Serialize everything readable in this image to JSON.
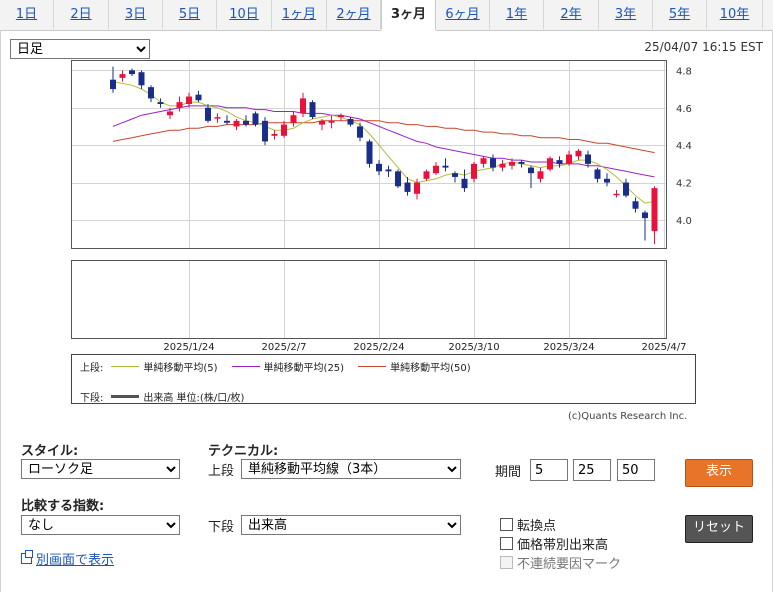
{
  "tabs": [
    "1日",
    "2日",
    "3日",
    "5日",
    "10日",
    "1ヶ月",
    "2ヶ月",
    "3ヶ月",
    "6ヶ月",
    "1年",
    "2年",
    "3年",
    "5年",
    "10年"
  ],
  "active_tab": "3ヶ月",
  "chart_type_select": "日足",
  "timestamp": "25/04/07 16:15 EST",
  "copyright": "(c)Quants Research Inc.",
  "legend": {
    "upper_label": "上段:",
    "lower_label": "下段:",
    "ma5": "単純移動平均(5)",
    "ma25": "単純移動平均(25)",
    "ma50": "単純移動平均(50)",
    "volume": "出来高 単位:(株/口/枚)"
  },
  "colors": {
    "up": "#e8123c",
    "down": "#1a2d8a",
    "ma5": "#b0be3a",
    "ma25": "#9a22c8",
    "ma50": "#c8472c",
    "volume": "#555555",
    "show_button": "#e8742a",
    "reset_button": "#555555"
  },
  "controls": {
    "style_label": "スタイル:",
    "style_value": "ローソク足",
    "technical_label": "テクニカル:",
    "upper_sub": "上段",
    "upper_value": "単純移動平均線（3本）",
    "period_label": "期間",
    "period1": "5",
    "period2": "25",
    "period3": "50",
    "show_button": "表示",
    "compare_label": "比較する指数:",
    "compare_value": "なし",
    "lower_sub": "下段",
    "lower_value": "出来高",
    "reset_button": "リセット",
    "check_turning": "転換点",
    "check_price_volume": "価格帯別出来高",
    "check_discontinuity": "不連続要因マーク",
    "open_window_link": "別画面で表示"
  },
  "chart_data": {
    "type": "candlestick",
    "x_tick_labels": [
      "2025/1/24",
      "2025/2/7",
      "2025/2/24",
      "2025/3/10",
      "2025/3/24",
      "2025/4/7"
    ],
    "x_tick_index": [
      8,
      18,
      28,
      38,
      48,
      58
    ],
    "ylim": [
      3.85,
      4.85
    ],
    "y_ticks": [
      4.0,
      4.2,
      4.4,
      4.6,
      4.8
    ],
    "grid": true,
    "candles": [
      [
        4.75,
        4.82,
        4.68,
        4.7
      ],
      [
        4.76,
        4.8,
        4.74,
        4.78
      ],
      [
        4.8,
        4.81,
        4.77,
        4.78
      ],
      [
        4.79,
        4.8,
        4.7,
        4.72
      ],
      [
        4.71,
        4.72,
        4.63,
        4.65
      ],
      [
        4.63,
        4.65,
        4.6,
        4.62
      ],
      [
        4.56,
        4.6,
        4.54,
        4.58
      ],
      [
        4.6,
        4.66,
        4.58,
        4.63
      ],
      [
        4.62,
        4.68,
        4.6,
        4.66
      ],
      [
        4.67,
        4.69,
        4.63,
        4.64
      ],
      [
        4.6,
        4.62,
        4.52,
        4.53
      ],
      [
        4.55,
        4.57,
        4.52,
        4.55
      ],
      [
        4.53,
        4.56,
        4.51,
        4.52
      ],
      [
        4.5,
        4.54,
        4.48,
        4.53
      ],
      [
        4.53,
        4.56,
        4.5,
        4.51
      ],
      [
        4.57,
        4.58,
        4.5,
        4.51
      ],
      [
        4.53,
        4.55,
        4.4,
        4.42
      ],
      [
        4.45,
        4.48,
        4.43,
        4.46
      ],
      [
        4.45,
        4.53,
        4.44,
        4.51
      ],
      [
        4.52,
        4.58,
        4.5,
        4.56
      ],
      [
        4.57,
        4.68,
        4.55,
        4.65
      ],
      [
        4.63,
        4.64,
        4.54,
        4.55
      ],
      [
        4.51,
        4.54,
        4.48,
        4.53
      ],
      [
        4.52,
        4.56,
        4.49,
        4.53
      ],
      [
        4.55,
        4.57,
        4.53,
        4.56
      ],
      [
        4.54,
        4.55,
        4.5,
        4.51
      ],
      [
        4.5,
        4.52,
        4.42,
        4.44
      ],
      [
        4.42,
        4.43,
        4.28,
        4.3
      ],
      [
        4.3,
        4.32,
        4.24,
        4.26
      ],
      [
        4.27,
        4.29,
        4.23,
        4.26
      ],
      [
        4.26,
        4.27,
        4.17,
        4.18
      ],
      [
        4.2,
        4.23,
        4.13,
        4.15
      ],
      [
        4.14,
        4.22,
        4.11,
        4.2
      ],
      [
        4.22,
        4.27,
        4.21,
        4.26
      ],
      [
        4.25,
        4.31,
        4.24,
        4.29
      ],
      [
        4.29,
        4.33,
        4.26,
        4.28
      ],
      [
        4.25,
        4.26,
        4.2,
        4.23
      ],
      [
        4.22,
        4.27,
        4.15,
        4.17
      ],
      [
        4.22,
        4.31,
        4.2,
        4.3
      ],
      [
        4.3,
        4.34,
        4.28,
        4.33
      ],
      [
        4.33,
        4.35,
        4.26,
        4.28
      ],
      [
        4.28,
        4.32,
        4.26,
        4.3
      ],
      [
        4.29,
        4.33,
        4.27,
        4.31
      ],
      [
        4.31,
        4.32,
        4.28,
        4.3
      ],
      [
        4.28,
        4.29,
        4.17,
        4.25
      ],
      [
        4.22,
        4.28,
        4.2,
        4.26
      ],
      [
        4.27,
        4.34,
        4.26,
        4.33
      ],
      [
        4.32,
        4.34,
        4.28,
        4.3
      ],
      [
        4.3,
        4.37,
        4.29,
        4.35
      ],
      [
        4.34,
        4.38,
        4.32,
        4.37
      ],
      [
        4.35,
        4.37,
        4.28,
        4.3
      ],
      [
        4.27,
        4.28,
        4.2,
        4.22
      ],
      [
        4.22,
        4.25,
        4.18,
        4.2
      ],
      [
        4.14,
        4.16,
        4.12,
        4.14
      ],
      [
        4.2,
        4.22,
        4.12,
        4.13
      ],
      [
        4.1,
        4.12,
        4.04,
        4.06
      ],
      [
        4.04,
        4.05,
        3.89,
        4.01
      ],
      [
        3.94,
        4.18,
        3.87,
        4.17
      ]
    ],
    "ma5": [
      4.74,
      4.73,
      4.72,
      4.7,
      4.67,
      4.63,
      4.61,
      4.61,
      4.63,
      4.63,
      4.61,
      4.6,
      4.58,
      4.55,
      4.53,
      4.52,
      4.5,
      4.48,
      4.48,
      4.49,
      4.52,
      4.54,
      4.55,
      4.56,
      4.55,
      4.53,
      4.51,
      4.46,
      4.4,
      4.34,
      4.28,
      4.22,
      4.2,
      4.21,
      4.22,
      4.24,
      4.25,
      4.24,
      4.26,
      4.27,
      4.28,
      4.3,
      4.31,
      4.3,
      4.29,
      4.28,
      4.29,
      4.29,
      4.3,
      4.32,
      4.32,
      4.3,
      4.27,
      4.23,
      4.18,
      4.13,
      4.09,
      4.1
    ],
    "ma25": [
      4.5,
      4.52,
      4.54,
      4.56,
      4.57,
      4.58,
      4.59,
      4.6,
      4.61,
      4.61,
      4.61,
      4.61,
      4.6,
      4.6,
      4.6,
      4.59,
      4.59,
      4.58,
      4.58,
      4.58,
      4.57,
      4.57,
      4.57,
      4.56,
      4.56,
      4.55,
      4.54,
      4.52,
      4.5,
      4.48,
      4.46,
      4.44,
      4.42,
      4.41,
      4.39,
      4.38,
      4.37,
      4.36,
      4.35,
      4.34,
      4.33,
      4.33,
      4.32,
      4.32,
      4.31,
      4.31,
      4.31,
      4.3,
      4.3,
      4.3,
      4.29,
      4.29,
      4.28,
      4.27,
      4.26,
      4.25,
      4.24,
      4.23
    ],
    "ma50": [
      4.42,
      4.43,
      4.44,
      4.45,
      4.46,
      4.47,
      4.48,
      4.48,
      4.49,
      4.49,
      4.5,
      4.5,
      4.51,
      4.51,
      4.51,
      4.51,
      4.52,
      4.52,
      4.52,
      4.52,
      4.52,
      4.52,
      4.53,
      4.53,
      4.53,
      4.53,
      4.53,
      4.53,
      4.53,
      4.52,
      4.52,
      4.51,
      4.51,
      4.5,
      4.5,
      4.49,
      4.49,
      4.48,
      4.48,
      4.47,
      4.47,
      4.46,
      4.46,
      4.45,
      4.45,
      4.44,
      4.44,
      4.44,
      4.43,
      4.43,
      4.42,
      4.41,
      4.41,
      4.4,
      4.39,
      4.38,
      4.37,
      4.36
    ]
  }
}
